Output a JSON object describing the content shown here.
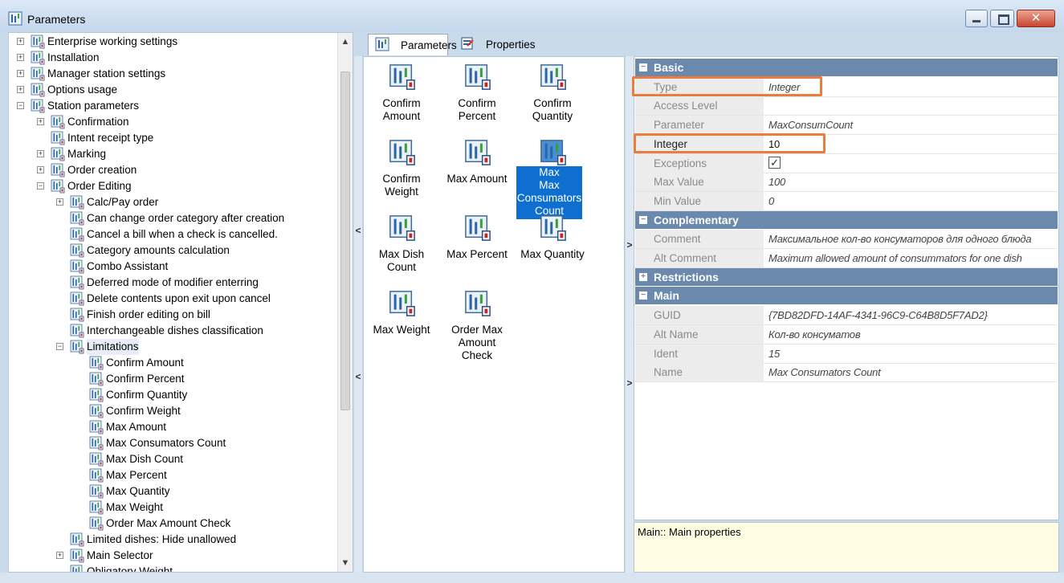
{
  "window": {
    "title": "Parameters",
    "close_glyph": "✕"
  },
  "tree": {
    "nodes": [
      {
        "label": "Enterprise working settings",
        "level": 1,
        "expander": "+"
      },
      {
        "label": "Installation",
        "level": 1,
        "expander": "+"
      },
      {
        "label": "Manager station settings",
        "level": 1,
        "expander": "+"
      },
      {
        "label": "Options usage",
        "level": 1,
        "expander": "+"
      },
      {
        "label": "Station parameters",
        "level": 1,
        "expander": "−"
      },
      {
        "label": "Confirmation",
        "level": 2,
        "expander": "+"
      },
      {
        "label": "Intent receipt type",
        "level": 2,
        "expander": ""
      },
      {
        "label": "Marking",
        "level": 2,
        "expander": "+"
      },
      {
        "label": "Order creation",
        "level": 2,
        "expander": "+"
      },
      {
        "label": "Order Editing",
        "level": 2,
        "expander": "−"
      },
      {
        "label": "Calc/Pay order",
        "level": 3,
        "expander": "+"
      },
      {
        "label": "Can change order category after creation",
        "level": 3,
        "expander": ""
      },
      {
        "label": "Cancel a bill when a check is cancelled.",
        "level": 3,
        "expander": ""
      },
      {
        "label": "Category amounts calculation",
        "level": 3,
        "expander": ""
      },
      {
        "label": "Combo Assistant",
        "level": 3,
        "expander": ""
      },
      {
        "label": "Deferred mode of modifier enterring",
        "level": 3,
        "expander": ""
      },
      {
        "label": "Delete contents upon exit upon cancel",
        "level": 3,
        "expander": ""
      },
      {
        "label": "Finish order editing on bill",
        "level": 3,
        "expander": ""
      },
      {
        "label": "Interchangeable dishes classification",
        "level": 3,
        "expander": ""
      },
      {
        "label": "Limitations",
        "level": 3,
        "expander": "−",
        "selected": true
      },
      {
        "label": "Confirm Amount",
        "level": 4,
        "expander": ""
      },
      {
        "label": "Confirm Percent",
        "level": 4,
        "expander": ""
      },
      {
        "label": "Confirm Quantity",
        "level": 4,
        "expander": ""
      },
      {
        "label": "Confirm Weight",
        "level": 4,
        "expander": ""
      },
      {
        "label": "Max Amount",
        "level": 4,
        "expander": ""
      },
      {
        "label": "Max Consumators Count",
        "level": 4,
        "expander": ""
      },
      {
        "label": "Max Dish Count",
        "level": 4,
        "expander": ""
      },
      {
        "label": "Max Percent",
        "level": 4,
        "expander": ""
      },
      {
        "label": "Max Quantity",
        "level": 4,
        "expander": ""
      },
      {
        "label": "Max Weight",
        "level": 4,
        "expander": ""
      },
      {
        "label": "Order Max Amount Check",
        "level": 4,
        "expander": ""
      },
      {
        "label": "Limited dishes: Hide unallowed",
        "level": 3,
        "expander": ""
      },
      {
        "label": "Main Selector",
        "level": 3,
        "expander": "+"
      },
      {
        "label": "Obligatory Weight",
        "level": 3,
        "expander": ""
      }
    ],
    "scroll_up": "▲",
    "scroll_down": "▼"
  },
  "tabs": [
    {
      "label": "Parameters",
      "active": true
    },
    {
      "label": "Properties",
      "active": false
    }
  ],
  "gutter": {
    "left_collapse": "<",
    "right_collapse": ">"
  },
  "tiles": [
    {
      "label1": "Confirm",
      "label2": "Amount"
    },
    {
      "label1": "Confirm",
      "label2": "Percent"
    },
    {
      "label1": "Confirm",
      "label2": "Quantity"
    },
    {
      "label1": "Confirm",
      "label2": "Weight"
    },
    {
      "label1": "Max Amount",
      "label2": ""
    },
    {
      "label1": "Max Consumators",
      "label2": "Count",
      "label0": "Max",
      "selected": true
    },
    {
      "label1": "Max Dish",
      "label2": "Count"
    },
    {
      "label1": "Max Percent",
      "label2": ""
    },
    {
      "label1": "Max Quantity",
      "label2": ""
    },
    {
      "label1": "Max Weight",
      "label2": ""
    },
    {
      "label1": "Order Max",
      "label2": "Amount Check"
    }
  ],
  "properties": {
    "toggle_expanded": "−",
    "toggle_collapsed": "+",
    "checkbox_glyph": "✓",
    "categories": [
      {
        "name": "Basic",
        "expanded": true,
        "rows": [
          {
            "key": "Type",
            "value": "Integer"
          },
          {
            "key": "Access Level",
            "value": ""
          },
          {
            "key": "Parameter",
            "value": "MaxConsumCount"
          },
          {
            "key": "Integer",
            "value": "10",
            "black": true
          },
          {
            "key": "Exceptions",
            "value": "",
            "checkbox": true
          },
          {
            "key": "Max Value",
            "value": "100"
          },
          {
            "key": "Min Value",
            "value": "0"
          }
        ]
      },
      {
        "name": "Complementary",
        "expanded": true,
        "rows": [
          {
            "key": "Comment",
            "value": "Максимальное кол-во консуматоров для одного блюда"
          },
          {
            "key": "Alt Comment",
            "value": "Maximum allowed amount of consummators for one dish"
          }
        ]
      },
      {
        "name": "Restrictions",
        "expanded": false,
        "rows": []
      },
      {
        "name": "Main",
        "expanded": true,
        "rows": [
          {
            "key": "GUID",
            "value": "{7BD82DFD-14AF-4341-96C9-C64B8D5F7AD2}"
          },
          {
            "key": "Alt Name",
            "value": "Кол-во консуматов"
          },
          {
            "key": "Ident",
            "value": "15"
          },
          {
            "key": "Name",
            "value": "Max Consumators Count"
          }
        ]
      }
    ]
  },
  "description": "Main:: Main properties",
  "colors": {
    "accent": "#ec7b3c",
    "selection": "#0f6fd0",
    "category": "#6a89ad"
  }
}
